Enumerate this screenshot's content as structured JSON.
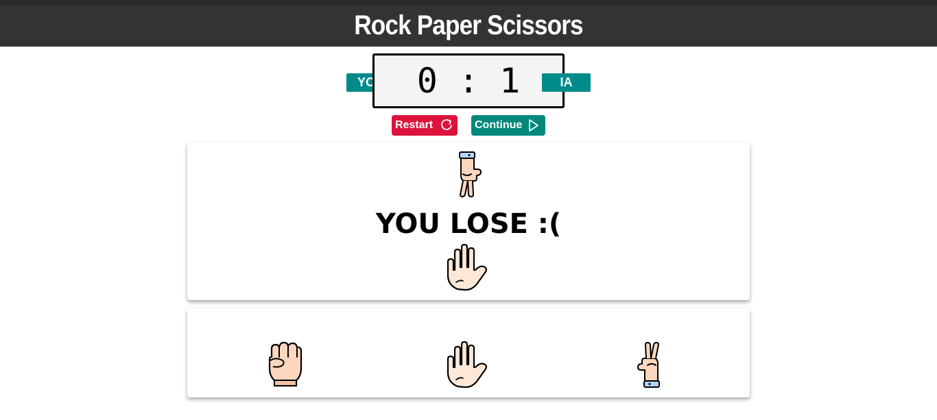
{
  "header": {
    "title": "Rock Paper Scissors"
  },
  "score": {
    "you": 0,
    "ia": 1,
    "separator": ":"
  },
  "labels": {
    "you": "YOU",
    "ia": "IA"
  },
  "buttons": {
    "restart": "Restart",
    "continue": "Continue"
  },
  "result": {
    "text": "YOU LOSE :(",
    "ia_choice_icon": "scissors-hand-icon",
    "player_choice_icon": "paper-hand-icon"
  },
  "choices": [
    {
      "name": "rock",
      "icon": "rock-fist-icon"
    },
    {
      "name": "paper",
      "icon": "paper-hand-icon"
    },
    {
      "name": "scissors",
      "icon": "scissors-hand-icon"
    }
  ],
  "colors": {
    "header_bg": "#333333",
    "tag_bg": "#008b8b",
    "restart_bg": "#dc143c",
    "continue_bg": "#00897b",
    "skin": "#fcd6bf",
    "cuff": "#b3d4f5"
  }
}
